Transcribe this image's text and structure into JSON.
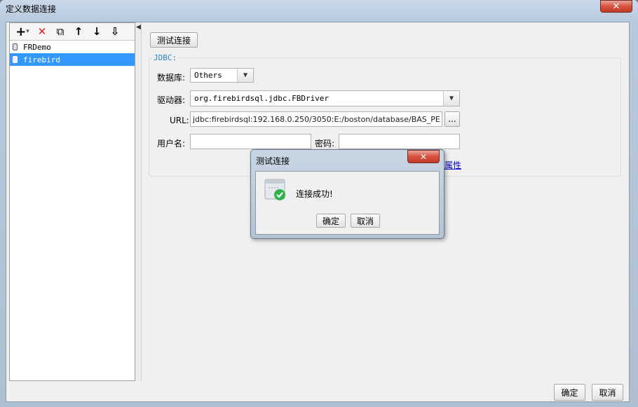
{
  "window": {
    "title": "定义数据连接",
    "close": "✕"
  },
  "toolbar": {
    "add": "+",
    "add_dropdown": "▾",
    "delete": "✕",
    "copy": "⧉",
    "move_up": "↑",
    "move_down": "↓",
    "sort": "⇩"
  },
  "connections": [
    {
      "label": "FRDemo",
      "selected": false
    },
    {
      "label": "firebird",
      "selected": true
    }
  ],
  "splitter_arrow": "◀",
  "test_button": "测试连接",
  "jdbc": {
    "legend": "JDBC:",
    "database_label": "数据库:",
    "database_value": "Others",
    "driver_label": "驱动器:",
    "driver_value": "org.firebirdsql.jdbc.FBDriver",
    "url_label": "URL:",
    "url_value": "jdbc:firebirdsql:192.168.0.250/3050:E:/boston/database/BAS_PE",
    "url_browse": "...",
    "username_label": "用户名:",
    "username_value": "",
    "password_label": "密码:",
    "password_value": "",
    "properties_link": "属性"
  },
  "dialog": {
    "title": "测试连接",
    "close": "✕",
    "message": "连接成功!",
    "ok": "确定",
    "cancel": "取消"
  },
  "footer": {
    "ok": "确定",
    "cancel": "取消"
  }
}
